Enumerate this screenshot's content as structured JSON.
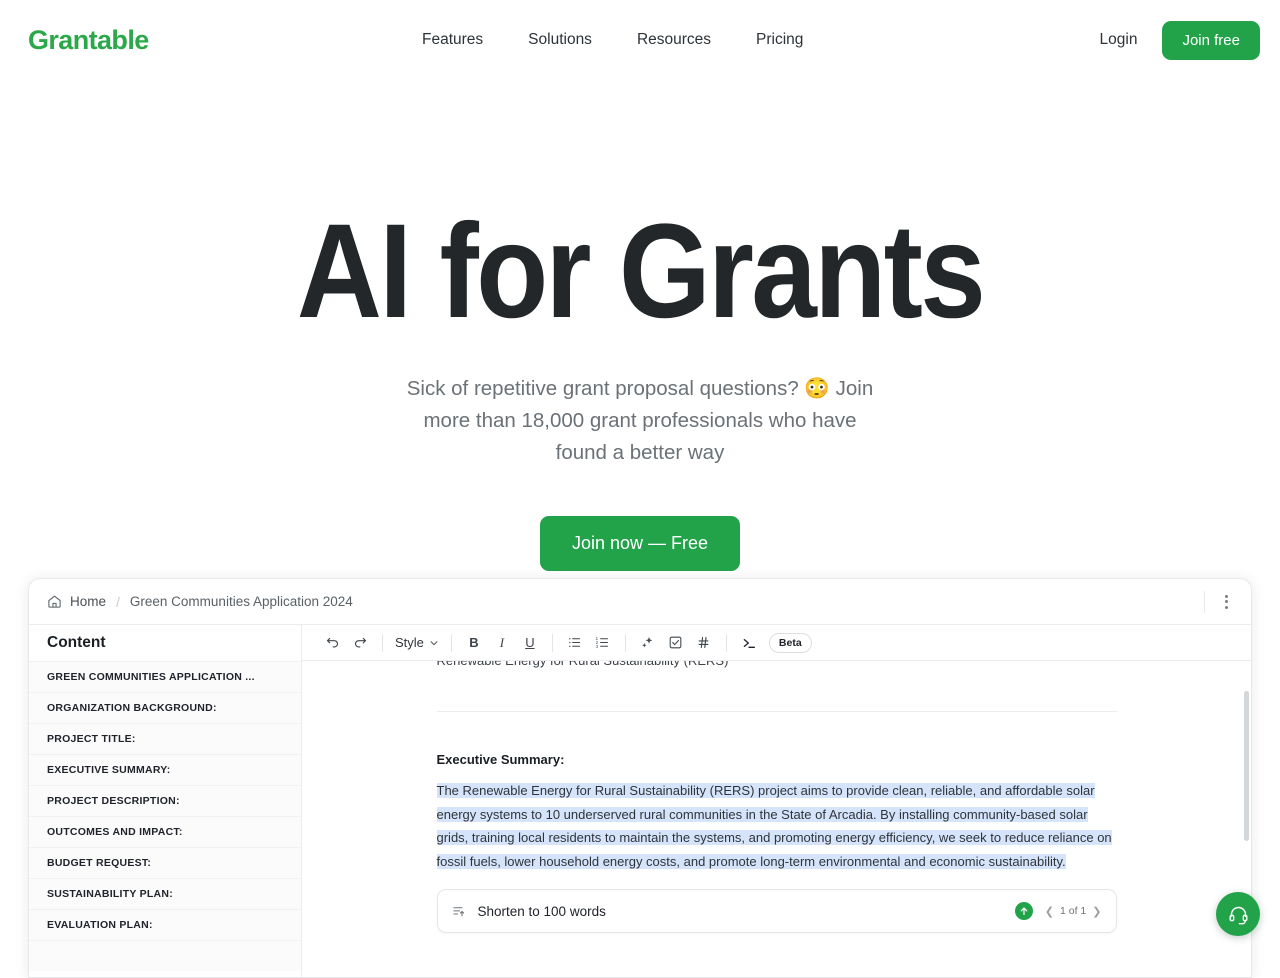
{
  "nav": {
    "logo": "Grantable",
    "links": [
      {
        "label": "Features"
      },
      {
        "label": "Solutions"
      },
      {
        "label": "Resources"
      },
      {
        "label": "Pricing"
      }
    ],
    "login_label": "Login",
    "join_free_label": "Join free"
  },
  "hero": {
    "title": "AI for Grants",
    "subtitle": "Sick of repetitive grant proposal questions? 😳 Join more than 18,000 grant professionals who have found a better way",
    "cta_label": "Join now — Free"
  },
  "app": {
    "breadcrumb": {
      "home_label": "Home",
      "separator": "/",
      "current_label": "Green Communities Application 2024",
      "home_icon": "house-icon",
      "menu_icon": "kebab-menu-icon"
    },
    "sidebar": {
      "title": "Content",
      "items": [
        {
          "label": "GREEN COMMUNITIES APPLICATION ..."
        },
        {
          "label": "ORGANIZATION BACKGROUND:"
        },
        {
          "label": "PROJECT TITLE:"
        },
        {
          "label": "EXECUTIVE SUMMARY:"
        },
        {
          "label": "PROJECT DESCRIPTION:"
        },
        {
          "label": "OUTCOMES AND IMPACT:"
        },
        {
          "label": "BUDGET REQUEST:"
        },
        {
          "label": "SUSTAINABILITY PLAN:"
        },
        {
          "label": "EVALUATION PLAN:"
        }
      ]
    },
    "toolbar": {
      "undo_icon": "undo-icon",
      "redo_icon": "redo-icon",
      "style_label": "Style",
      "style_caret_icon": "chevron-down-icon",
      "bold_label": "B",
      "italic_label": "I",
      "underline_label": "U",
      "bullet_list_icon": "bullet-list-icon",
      "numbered_list_icon": "numbered-list-icon",
      "ai_sparkle_icon": "sparkle-icon",
      "checkbox_icon": "checkbox-icon",
      "hash_icon": "hash-icon",
      "terminal_icon": "terminal-prompt-icon",
      "beta_label": "Beta"
    },
    "document": {
      "clipped_line": "Renewable Energy for Rural Sustainability (RERS)",
      "heading": "Executive Summary:",
      "paragraph": "The Renewable Energy for Rural Sustainability (RERS) project aims to provide clean, reliable, and affordable solar energy systems to 10 underserved rural communities in the State of Arcadia. By installing community-based solar grids, training local residents to maintain the systems, and promoting energy efficiency, we seek to reduce reliance on fossil fuels, lower household energy costs, and promote long-term environmental and economic sustainability."
    },
    "suggestion": {
      "icon": "shorten-text-icon",
      "label": "Shorten to 100 words",
      "accept_icon": "arrow-up-icon",
      "prev_icon": "chevron-left-icon",
      "next_icon": "chevron-right-icon",
      "pager_label": "1 of 1"
    },
    "support": {
      "icon": "headset-icon"
    }
  },
  "colors": {
    "brand_green": "#22A34A",
    "logo_green": "#2BA84A",
    "selection_blue": "#d6e4fb",
    "text_dark": "#242729",
    "text_muted": "#6b7176"
  }
}
